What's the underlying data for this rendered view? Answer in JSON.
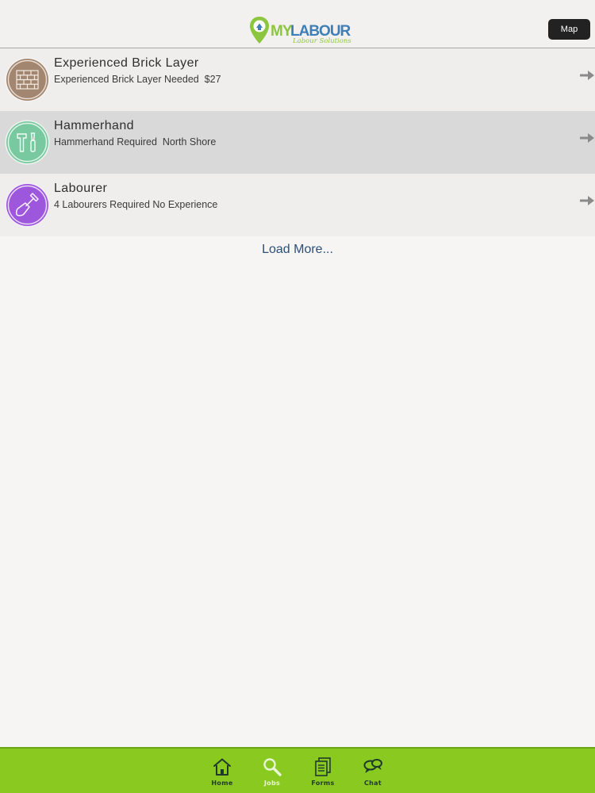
{
  "header": {
    "logo": {
      "my": "MY",
      "labour": "LABOUR",
      "tagline": "Labour Solutions"
    },
    "map_button": "Map"
  },
  "jobs": [
    {
      "title": "Experienced Brick Layer",
      "subtitle": "Experienced Brick Layer Needed  $27",
      "icon": "brick-wall-icon",
      "color": "#a38670",
      "highlighted": false
    },
    {
      "title": "Hammerhand",
      "subtitle": "Hammerhand Required  North Shore",
      "icon": "hammer-screwdriver-icon",
      "color": "#79c9a0",
      "highlighted": true
    },
    {
      "title": "Labourer",
      "subtitle": "4 Labourers Required No Experience",
      "icon": "shovel-icon",
      "color": "#9d57dc",
      "highlighted": false
    }
  ],
  "load_more": "Load More...",
  "tabbar": {
    "tabs": [
      {
        "label": "Home",
        "icon": "home-icon",
        "active": false
      },
      {
        "label": "Jobs",
        "icon": "search-icon",
        "active": true
      },
      {
        "label": "Forms",
        "icon": "forms-icon",
        "active": false
      },
      {
        "label": "Chat",
        "icon": "chat-icon",
        "active": false
      }
    ]
  },
  "colors": {
    "brand_green": "#8ac920",
    "brand_blue": "#3d7fb6",
    "link": "#2c4f78"
  }
}
